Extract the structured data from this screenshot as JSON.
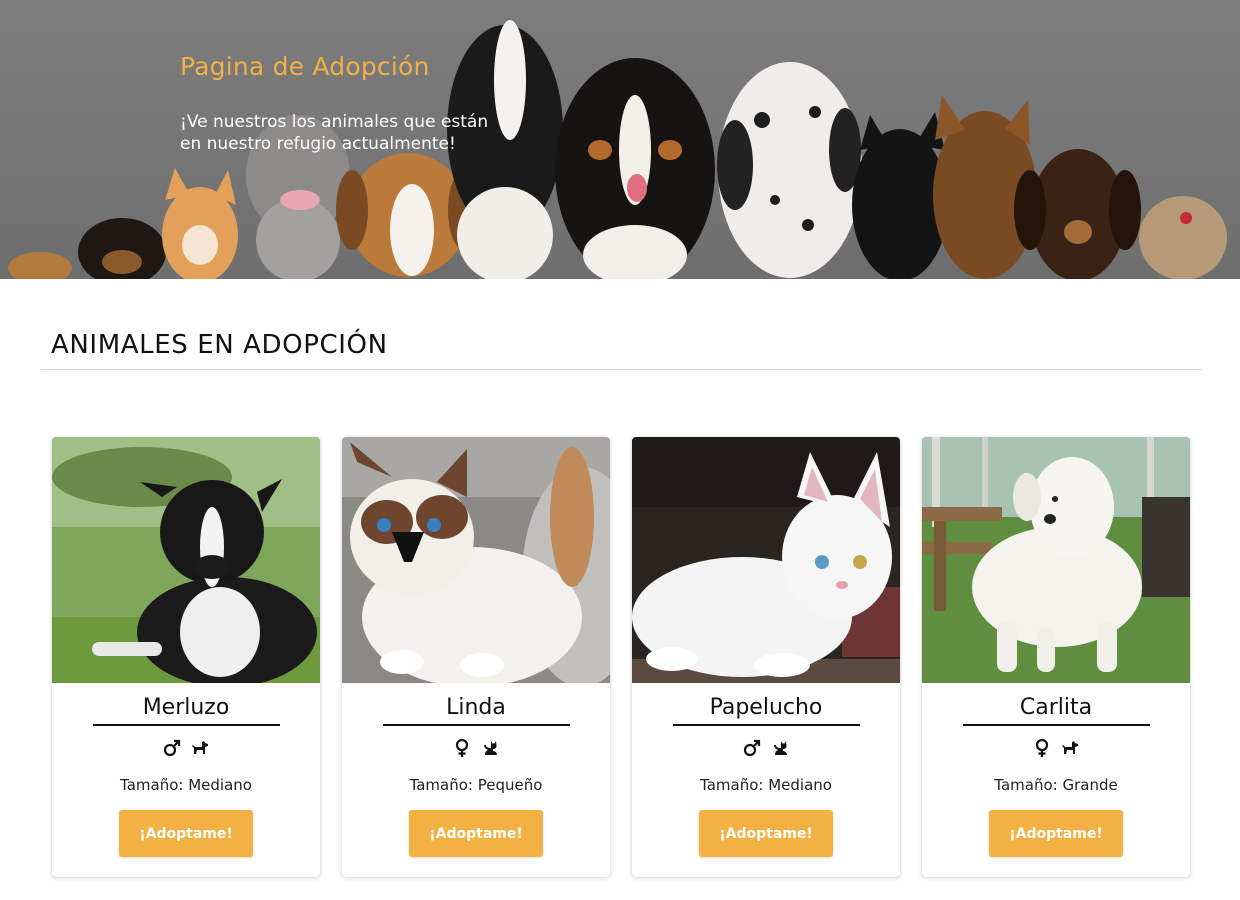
{
  "hero": {
    "title": "Pagina de Adopción",
    "subtitle_line1": "¡Ve nuestros los animales que están",
    "subtitle_line2": "en nuestro refugio actualmente!",
    "overlay_color": "#777777",
    "title_color": "#f0b045"
  },
  "section": {
    "title": "ANIMALES EN ADOPCIÓN"
  },
  "accent_color": "#f2b142",
  "animals": [
    {
      "name": "Merluzo",
      "sex": "male",
      "sex_icon": "male-icon",
      "species": "dog",
      "species_icon": "dog-icon",
      "size": "Tamaño: Mediano",
      "button": "¡Adoptame!"
    },
    {
      "name": "Linda",
      "sex": "female",
      "sex_icon": "female-icon",
      "species": "cat",
      "species_icon": "cat-icon",
      "size": "Tamaño: Pequeño",
      "button": "¡Adoptame!"
    },
    {
      "name": "Papelucho",
      "sex": "male",
      "sex_icon": "male-icon",
      "species": "cat",
      "species_icon": "cat-icon",
      "size": "Tamaño: Mediano",
      "button": "¡Adoptame!"
    },
    {
      "name": "Carlita",
      "sex": "female",
      "sex_icon": "female-icon",
      "species": "dog",
      "species_icon": "dog-icon",
      "size": "Tamaño: Grande",
      "button": "¡Adoptame!"
    }
  ]
}
